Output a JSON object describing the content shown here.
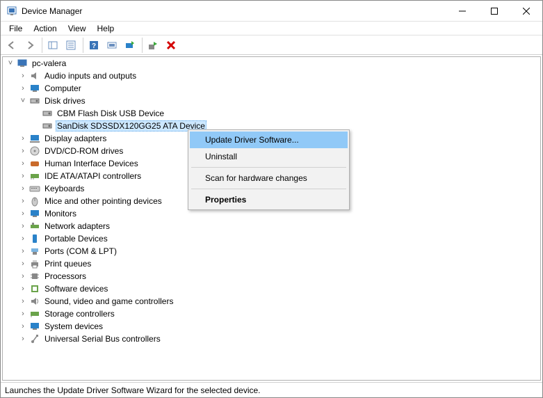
{
  "window": {
    "title": "Device Manager"
  },
  "menu": {
    "file": "File",
    "action": "Action",
    "view": "View",
    "help": "Help"
  },
  "tree": {
    "root": "pc-valera",
    "nodes": {
      "audio": "Audio inputs and outputs",
      "computer": "Computer",
      "disk": "Disk drives",
      "disk_children": {
        "cbm": "CBM Flash Disk USB Device",
        "sandisk": "SanDisk SDSSDX120GG25 ATA Device"
      },
      "display": "Display adapters",
      "dvd": "DVD/CD-ROM drives",
      "hid": "Human Interface Devices",
      "ide": "IDE ATA/ATAPI controllers",
      "keyboards": "Keyboards",
      "mice": "Mice and other pointing devices",
      "monitors": "Monitors",
      "network": "Network adapters",
      "portable": "Portable Devices",
      "ports": "Ports (COM & LPT)",
      "print": "Print queues",
      "processors": "Processors",
      "software": "Software devices",
      "sound": "Sound, video and game controllers",
      "storage": "Storage controllers",
      "system": "System devices",
      "usb": "Universal Serial Bus controllers"
    }
  },
  "context_menu": {
    "update": "Update Driver Software...",
    "uninstall": "Uninstall",
    "scan": "Scan for hardware changes",
    "properties": "Properties"
  },
  "statusbar": {
    "text": "Launches the Update Driver Software Wizard for the selected device."
  }
}
